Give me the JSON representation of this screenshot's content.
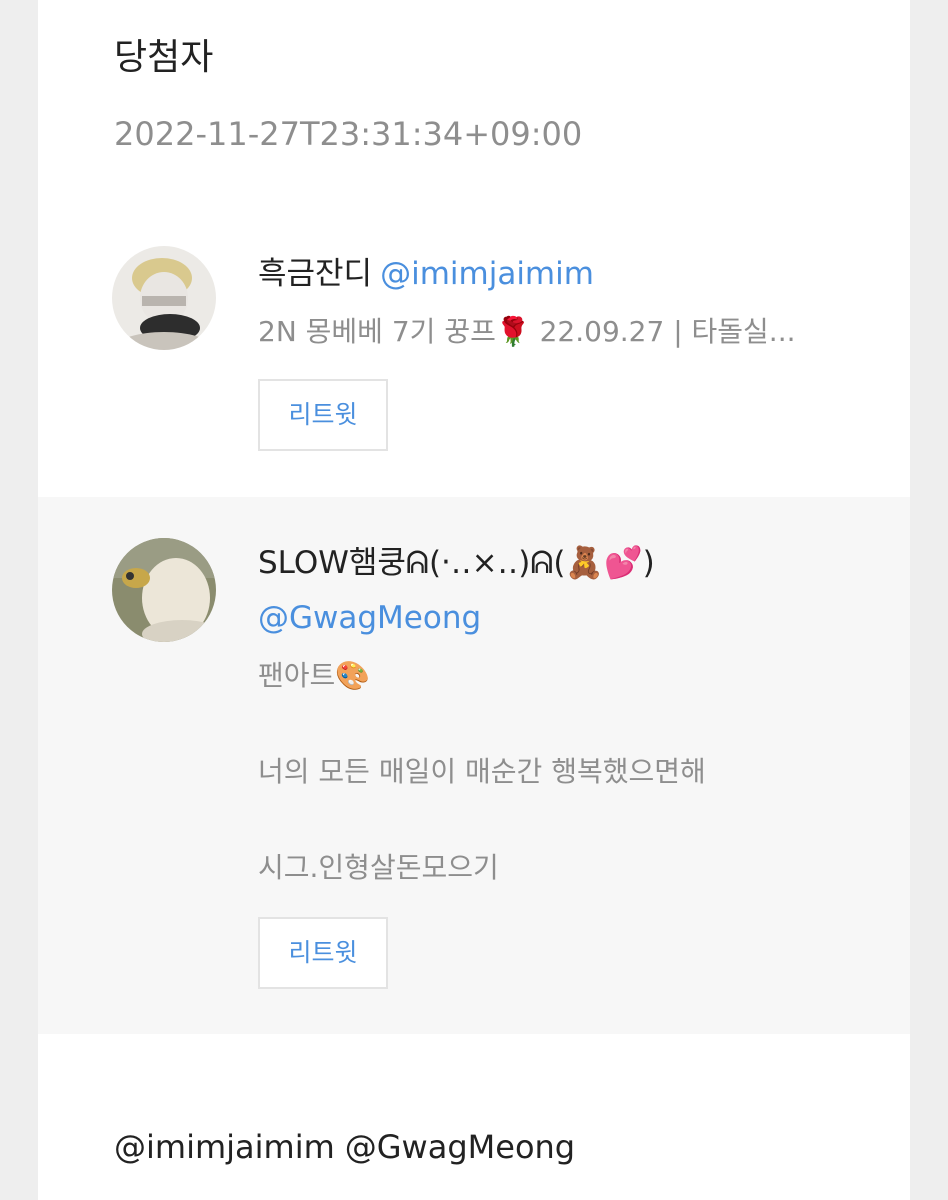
{
  "header": {
    "title": "당첨자",
    "timestamp": "2022-11-27T23:31:34+09:00"
  },
  "winners": [
    {
      "display_name": "흑금잔디",
      "handle": "@imimjaimim",
      "bio_lines": [
        "2N 몽베베 7기 꿍프🌹 22.09.27 | 타돌실..."
      ],
      "retweet_label": "리트윗"
    },
    {
      "display_name": "SLOW햄쿵ᕱ(‧‥×‥)ᕱ(🧸💕)",
      "handle": "@GwagMeong",
      "bio_lines": [
        "팬아트🎨",
        "",
        "너의 모든 매일이 매순간 행복했으면해",
        "",
        "시그.인형살돈모으기"
      ],
      "retweet_label": "리트윗"
    }
  ],
  "footer": {
    "mention_1": "@imimjaimim",
    "mention_2": "@GwagMeong"
  },
  "colors": {
    "link": "#4a8fde",
    "muted": "#8e8e8e",
    "text": "#222222",
    "page_background": "#eeeeee",
    "highlight_row": "#f7f7f7"
  }
}
